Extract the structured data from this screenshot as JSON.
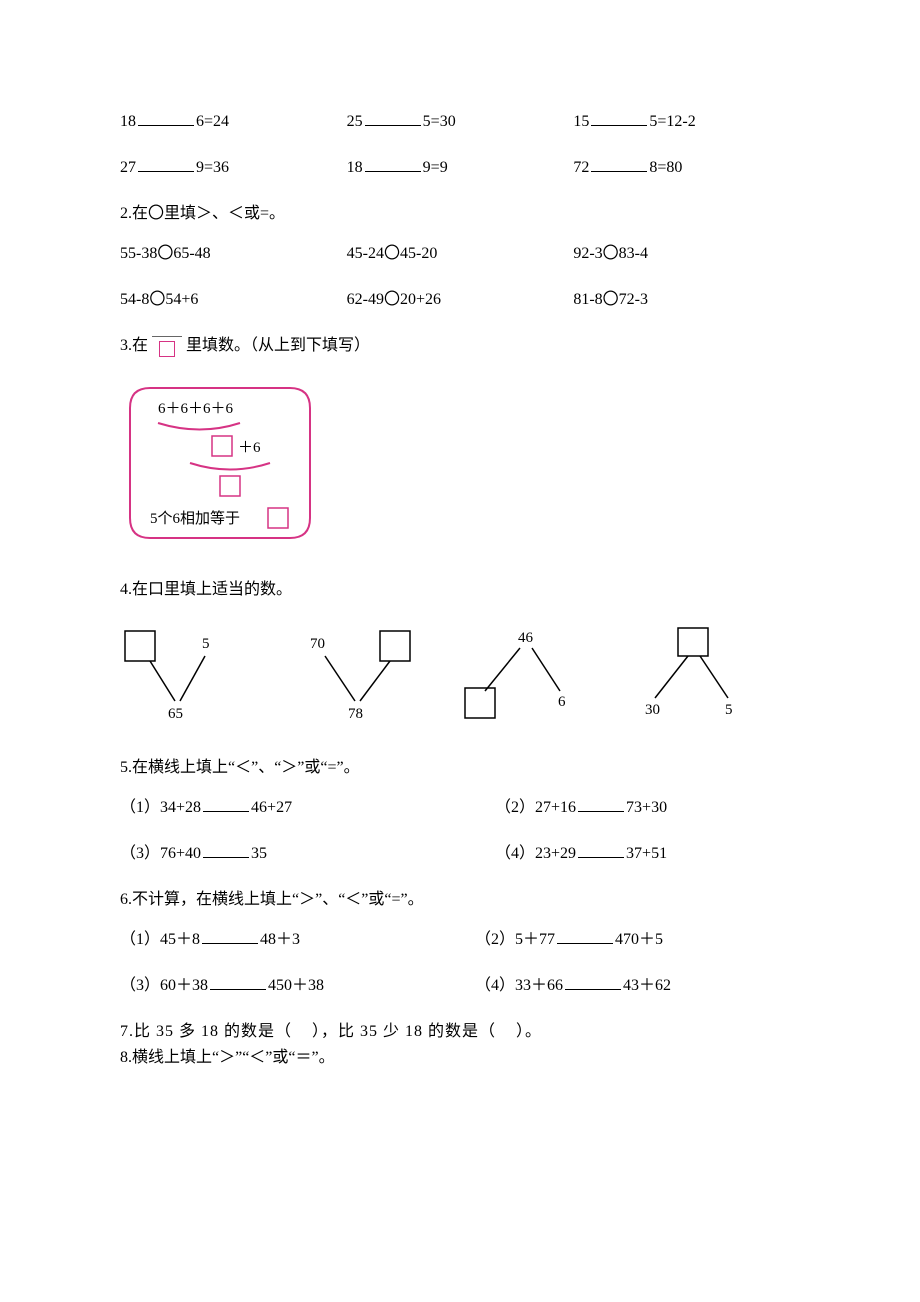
{
  "q1_rows": [
    [
      {
        "a": "18",
        "b": "6=24"
      },
      {
        "a": "25",
        "b": "5=30"
      },
      {
        "a": "15",
        "b": "5=12-2"
      }
    ],
    [
      {
        "a": "27",
        "b": "9=36"
      },
      {
        "a": "18",
        "b": "9=9"
      },
      {
        "a": "72",
        "b": "8=80"
      }
    ]
  ],
  "q2": {
    "title": "2.在〇里填＞、＜或=。",
    "rows": [
      [
        "55-38〇65-48",
        "45-24〇45-20",
        "92-3〇83-4"
      ],
      [
        "54-8〇54+6",
        "62-49〇20+26",
        "81-8〇72-3"
      ]
    ]
  },
  "q3": {
    "title_pre": "3.在",
    "title_post": "里填数。（从上到下填写）",
    "line1": "6＋6＋6＋6",
    "plus6": "＋6",
    "line3": "5个6相加等于"
  },
  "q4": {
    "title": "4.在口里填上适当的数。",
    "items": [
      {
        "top_left_box": true,
        "top_right": "5",
        "bottom": "65"
      },
      {
        "top_left": "70",
        "top_right_box": true,
        "bottom": "78"
      },
      {
        "top_center": "46",
        "bottom_left_box": true,
        "bottom_right": "6"
      },
      {
        "top_center_box": true,
        "bottom_left": "30",
        "bottom_right": "5"
      }
    ]
  },
  "q5": {
    "title": "5.在横线上填上“＜”、“＞”或“=”。",
    "items": [
      {
        "n": "（1）",
        "l": "34+28",
        "r": "46+27"
      },
      {
        "n": "（2）",
        "l": "27+16",
        "r": "73+30"
      },
      {
        "n": "（3）",
        "l": "76+40",
        "r": "35"
      },
      {
        "n": "（4）",
        "l": "23+29",
        "r": "37+51"
      }
    ]
  },
  "q6": {
    "title": "6.不计算，在横线上填上“＞”、“＜”或“=”。",
    "items": [
      {
        "n": "（1）",
        "l": "45＋8",
        "r": "48＋3"
      },
      {
        "n": "（2）",
        "l": "5＋77",
        "r": "470＋5"
      },
      {
        "n": "（3）",
        "l": "60＋38",
        "r": "450＋38"
      },
      {
        "n": "（4）",
        "l": "33＋66",
        "r": "43＋62"
      }
    ]
  },
  "q7": {
    "text_a": "7.比 35 多 18 的数是（",
    "text_b": "），比 35 少 18 的数是（",
    "text_c": "）。"
  },
  "q8": {
    "title": "8.横线上填上“＞”“＜”或“＝”。"
  }
}
